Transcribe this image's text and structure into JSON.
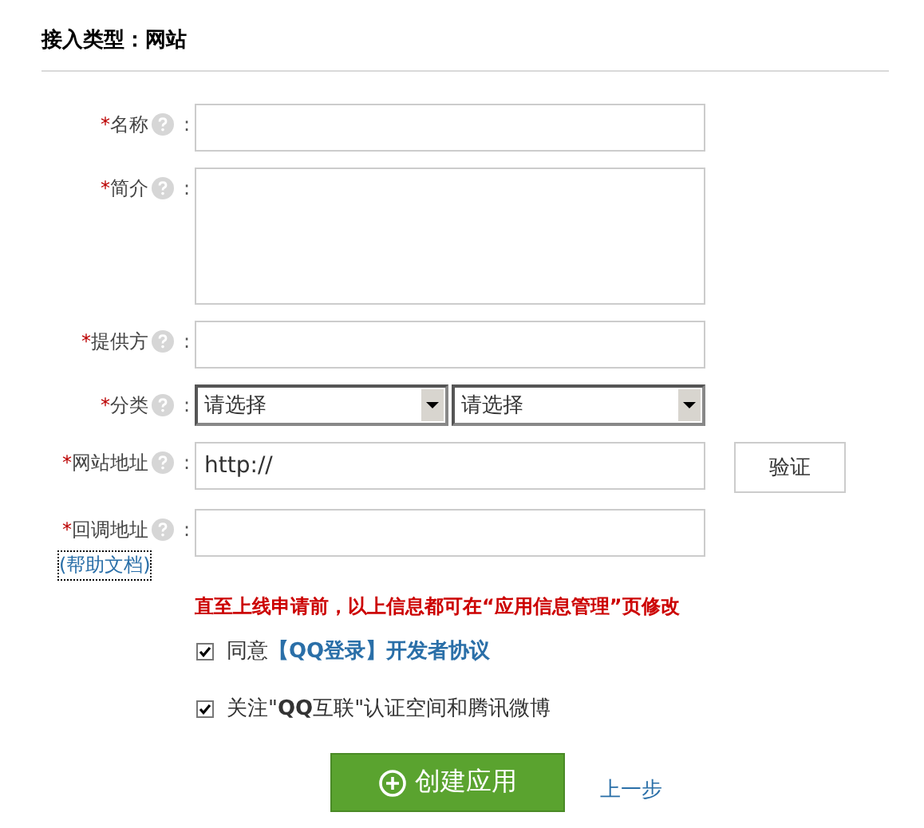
{
  "heading": "接入类型：网站",
  "fields": [
    {
      "kind": "text",
      "required_mark": "*",
      "label": "名称",
      "colon": ":"
    },
    {
      "kind": "textarea",
      "required_mark": "*",
      "label": "简介",
      "colon": ":"
    },
    {
      "kind": "text",
      "required_mark": "*",
      "label": "提供方",
      "colon": ":"
    },
    {
      "kind": "select",
      "required_mark": "*",
      "label": "分类",
      "colon": ":",
      "values": [
        "请选择",
        "请选择"
      ]
    },
    {
      "kind": "text",
      "required_mark": "*",
      "label": "网站地址",
      "colon": ":",
      "value": "http://",
      "action": "验证"
    },
    {
      "kind": "text",
      "required_mark": "*",
      "label": "回调地址",
      "colon": ":",
      "help_link": "(帮助文档)"
    }
  ],
  "notice": "直至上线申请前，以上信息都可在“应用信息管理”页修改",
  "checkboxes": [
    {
      "checked": true,
      "text": "同意",
      "link": "【QQ登录】开发者协议"
    },
    {
      "checked": true,
      "text": "关注\"**QQ**互联\"认证空间和腾讯微博"
    }
  ],
  "primary_button": "创建应用",
  "back_link": "上一步"
}
